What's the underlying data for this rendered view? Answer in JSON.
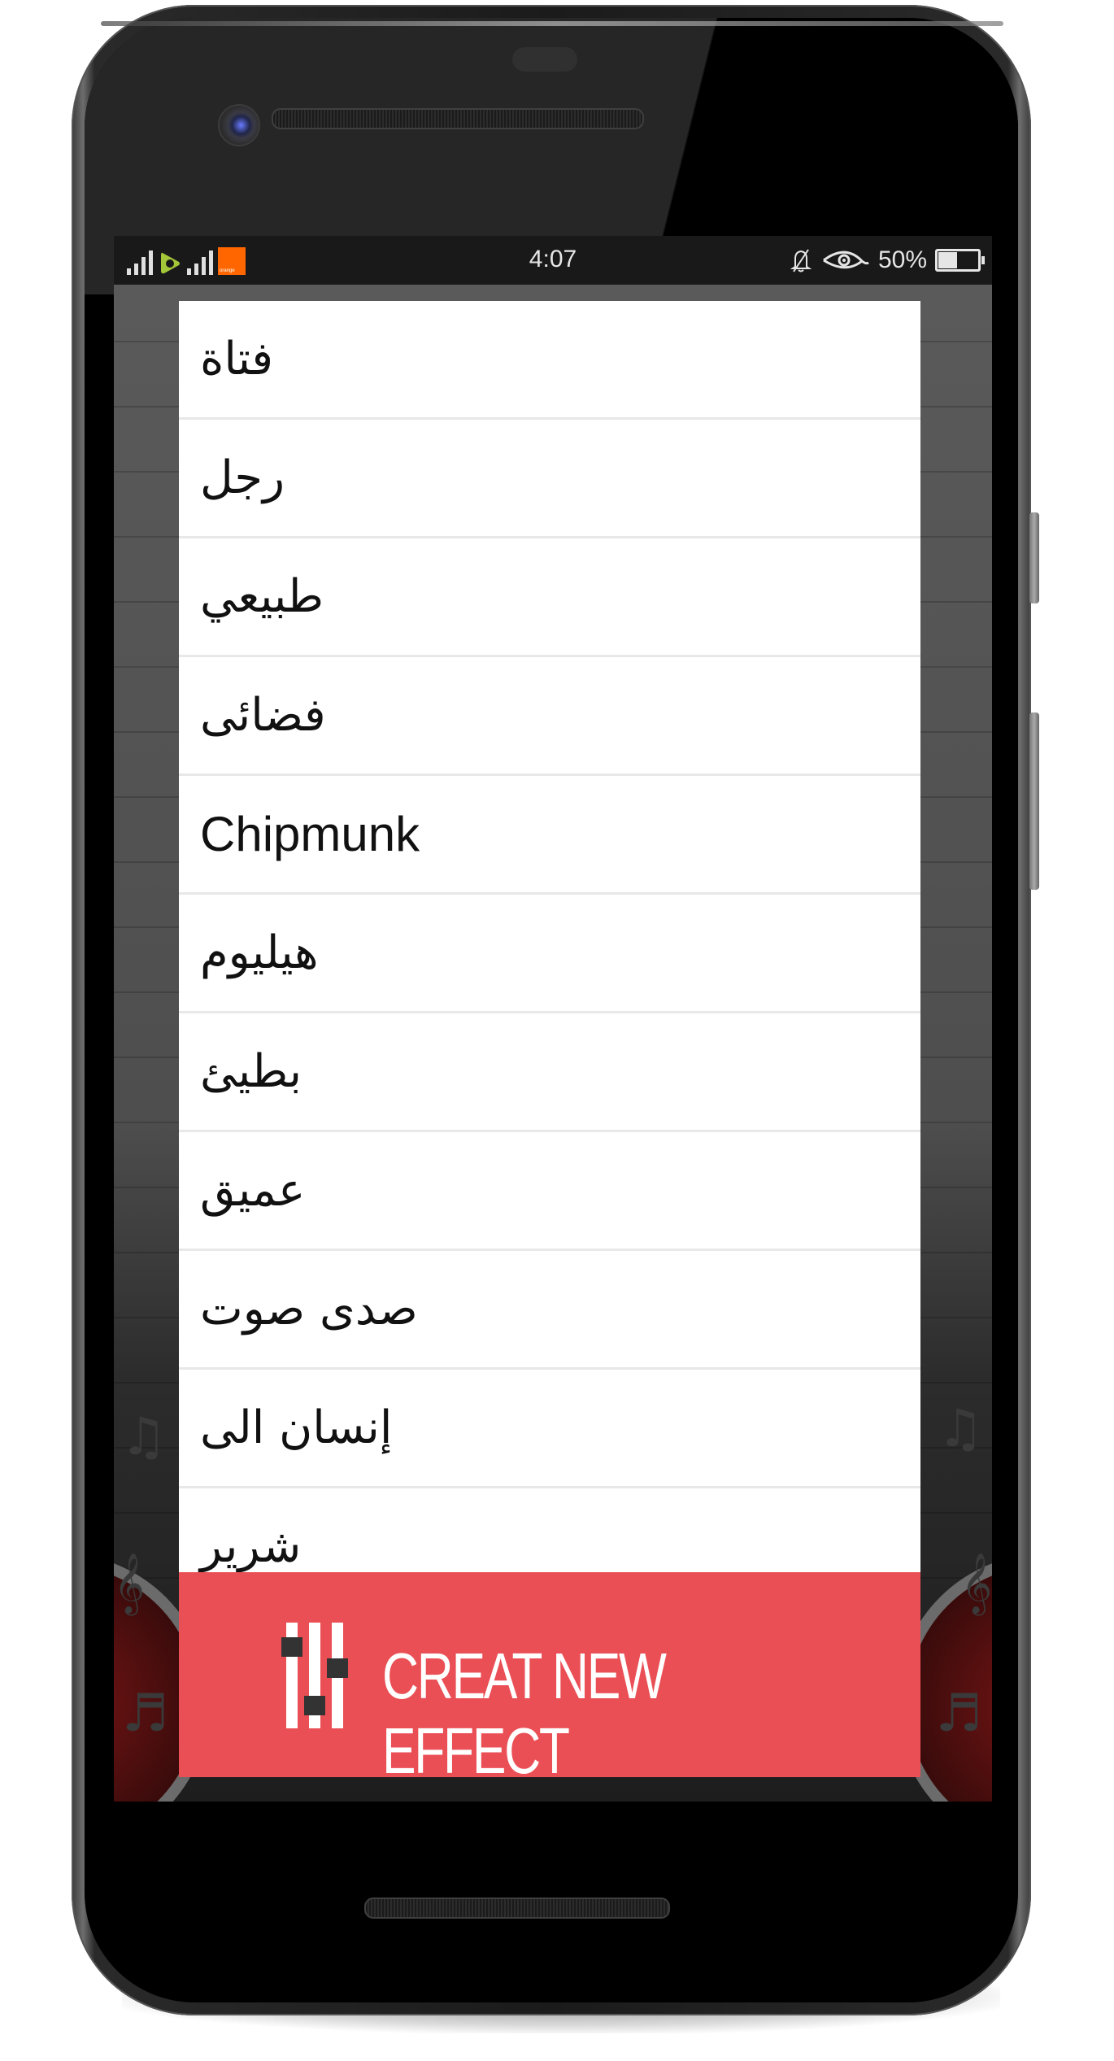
{
  "status_bar": {
    "carrier_1": "etisalat",
    "carrier_2_logo_text": "orange",
    "time": "4:07",
    "battery_percent": "50%",
    "battery_level": 0.5,
    "icons": [
      "signal-icon",
      "etisalat-logo-icon",
      "signal-icon",
      "orange-logo-icon",
      "notifications-off-icon",
      "eye-icon",
      "battery-icon"
    ]
  },
  "effects_list": {
    "items": [
      {
        "label": "فتاة",
        "dir": "rtl"
      },
      {
        "label": "رجل",
        "dir": "rtl"
      },
      {
        "label": "طبيعي",
        "dir": "rtl"
      },
      {
        "label": "فضائى",
        "dir": "rtl"
      },
      {
        "label": "Chipmunk",
        "dir": "ltr"
      },
      {
        "label": "هيليوم",
        "dir": "rtl"
      },
      {
        "label": "بطيئ",
        "dir": "rtl"
      },
      {
        "label": "عميق",
        "dir": "rtl"
      },
      {
        "label": "صدى صوت",
        "dir": "rtl"
      },
      {
        "label": "إنسان الى",
        "dir": "rtl"
      },
      {
        "label": "شرير",
        "dir": "rtl"
      }
    ]
  },
  "create_button": {
    "label": "CREAT NEW EFFECT",
    "icon": "equalizer-sliders-icon"
  },
  "colors": {
    "accent_red": "#ea4f55",
    "orange_brand": "#ff6600",
    "etisalat_green": "#a4c639"
  }
}
